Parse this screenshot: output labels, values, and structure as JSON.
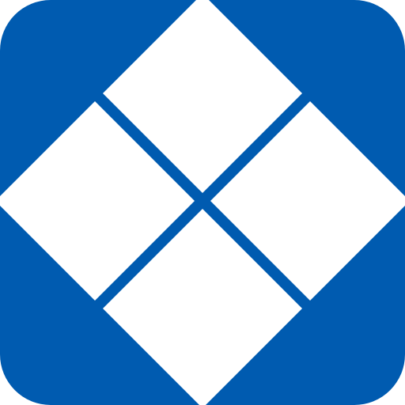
{
  "app_icon": {
    "icon_name": "four-diamonds-grid-icon",
    "background_color": "#005BB0",
    "tile_color": "#FFFFFF"
  }
}
